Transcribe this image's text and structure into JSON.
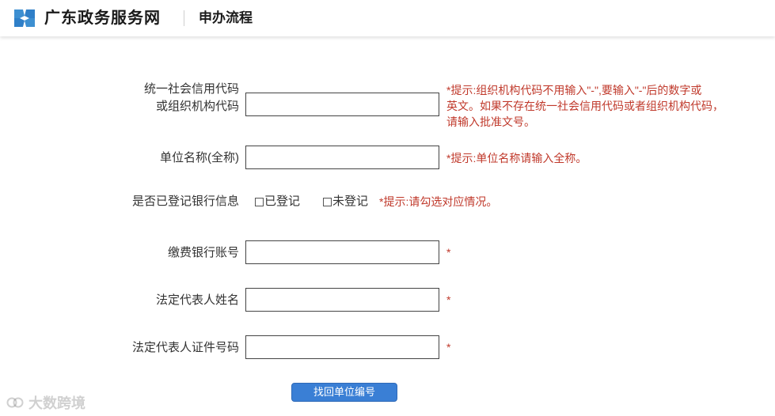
{
  "header": {
    "site_name": "广东政务服务网",
    "page_title": "申办流程"
  },
  "form": {
    "credit_code": {
      "label_line1": "统一社会信用代码",
      "label_line2": "或组织机构代码",
      "value": "",
      "hint_line1": "*提示:组织机构代码不用输入\"-\",要输入\"-\"后的数字或",
      "hint_line2": "英文。如果不存在统一社会信用代码或者组织机构代码，",
      "hint_line3": "请输入批准文号。"
    },
    "unit_name": {
      "label": "单位名称(全称)",
      "value": "",
      "hint": "*提示:单位名称请输入全称。"
    },
    "bank_registered": {
      "label": "是否已登记银行信息",
      "option_yes": "已登记",
      "option_no": "未登记",
      "hint": "*提示:请勾选对应情况。"
    },
    "bank_account": {
      "label": "缴费银行账号",
      "value": "",
      "required_mark": "*"
    },
    "legal_rep_name": {
      "label": "法定代表人姓名",
      "value": "",
      "required_mark": "*"
    },
    "legal_rep_id": {
      "label": "法定代表人证件号码",
      "value": "",
      "required_mark": "*"
    },
    "submit_label": "找回单位编号"
  },
  "watermark": {
    "text": "大数跨境"
  },
  "colors": {
    "hint_red": "#c0392b",
    "button_blue": "#3a7fd5",
    "logo_blue": "#2f7fc8"
  }
}
